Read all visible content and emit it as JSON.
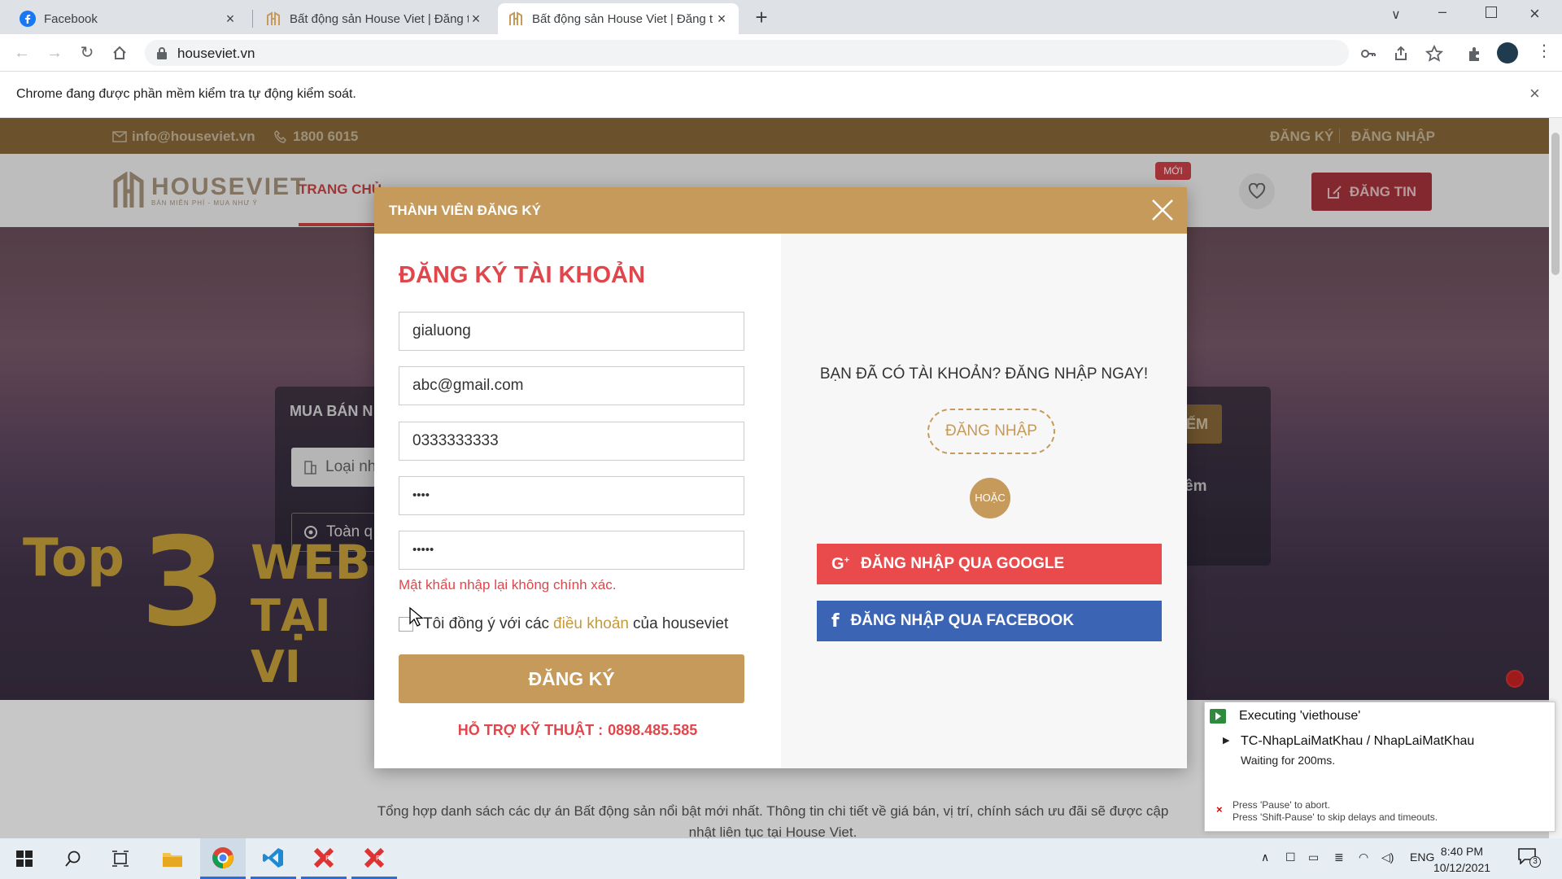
{
  "browser": {
    "tabs": [
      {
        "title": "Facebook",
        "active": false
      },
      {
        "title": "Bất động sản House Viet | Đăng t",
        "active": false
      },
      {
        "title": "Bất động sản House Viet | Đăng t",
        "active": true
      }
    ],
    "new_tab_label": "+",
    "url": "houseviet.vn",
    "infobar_message": "Chrome đang được phần mềm kiểm tra tự động kiểm soát."
  },
  "site": {
    "top": {
      "email": "info@houseviet.vn",
      "phone": "1800 6015",
      "register": "ĐĂNG KÝ",
      "login": "ĐĂNG NHẬP"
    },
    "logo": {
      "name": "HOUSEVIET",
      "tagline": "BÁN MIỄN PHÍ - MUA NHƯ Ý"
    },
    "nav": {
      "home": "TRANG CHỦ",
      "new_badge": "MỚI",
      "post_button": "ĐĂNG TIN"
    },
    "search": {
      "tab_label": "MUA BÁN N",
      "type_placeholder": "Loại nh",
      "location_placeholder": "Toàn q",
      "search_btn": "ẾM",
      "more": "êm"
    },
    "hero": {
      "line1": "Top",
      "big": "3",
      "line2": "WEBS",
      "line3": "TẠI VI"
    },
    "description": "Tổng hợp danh sách các dự án Bất động sản nổi bật mới nhất. Thông tin chi tiết về giá bán, vị trí, chính sách ưu đãi sẽ được cập nhật liên tục tại House Viet."
  },
  "modal": {
    "header": "THÀNH VIÊN ĐĂNG KÝ",
    "form": {
      "title": "ĐĂNG KÝ TÀI KHOẢN",
      "username": "gialuong",
      "email": "abc@gmail.com",
      "phone": "0333333333",
      "password": "••••",
      "confirm_password": "•••••",
      "error": "Mật khẩu nhập lại không chính xác.",
      "agree_prefix": "Tôi đồng ý với các",
      "agree_link": "điều khoản",
      "agree_suffix": "của houseviet",
      "submit": "ĐĂNG KÝ",
      "support_label": "HỖ TRỢ KỸ THUẬT :",
      "support_phone": "0898.485.585"
    },
    "side": {
      "has_account": "BẠN ĐÃ CÓ TÀI KHOẢN? ĐĂNG NHẬP NGAY!",
      "login": "ĐĂNG NHẬP",
      "or": "HOẶC",
      "google": "ĐĂNG NHẬP QUA GOOGLE",
      "facebook": "ĐĂNG NHẬP QUA FACEBOOK"
    }
  },
  "katalon": {
    "header": "Executing 'viethouse'",
    "step": "TC-NhapLaiMatKhau / NhapLaiMatKhau",
    "status": "Waiting for 200ms.",
    "hint1": "Press 'Pause' to abort.",
    "hint2": "Press 'Shift-Pause' to skip delays and timeouts."
  },
  "taskbar": {
    "lang": "ENG",
    "time": "8:40 PM",
    "date": "10/12/2021",
    "notif_count": "3"
  }
}
